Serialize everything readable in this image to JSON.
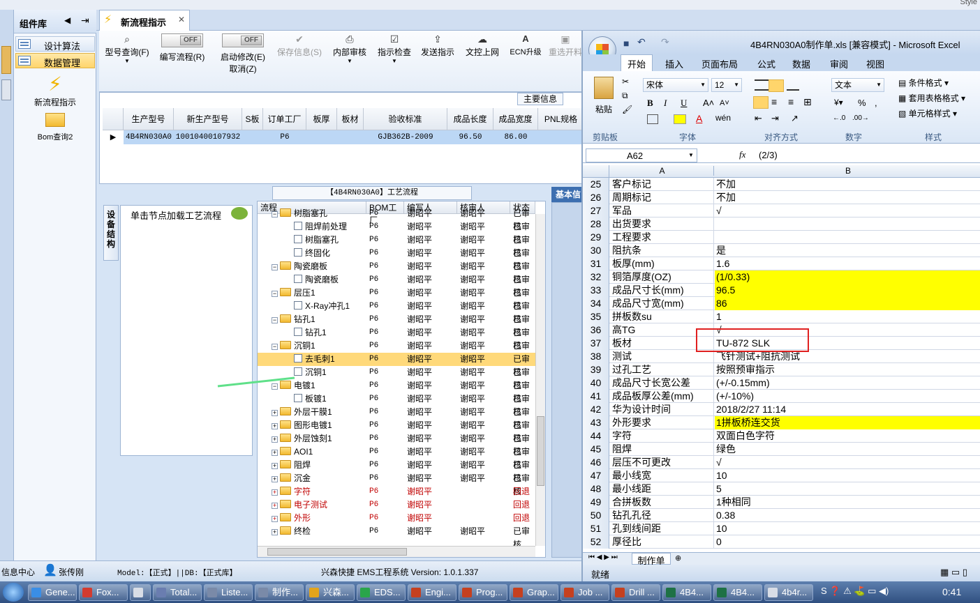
{
  "top": {
    "style_label": "Style"
  },
  "component_library": {
    "title": "组件库",
    "nav": [
      {
        "label": "设计算法"
      },
      {
        "label": "数据管理"
      }
    ],
    "shortcuts": [
      {
        "label": "新流程指示"
      },
      {
        "label": "Bom查询2"
      }
    ]
  },
  "doc_tab": {
    "label": "新流程指示"
  },
  "toolbar": {
    "items": [
      {
        "label": "型号查询(F)",
        "icon": "search-icon"
      },
      {
        "label": "编写流程(R)",
        "toggle": "OFF"
      },
      {
        "label": "启动修改(E)",
        "sub": "取消(Z)",
        "toggle": "OFF"
      },
      {
        "label": "保存信息(S)",
        "icon": "check-icon"
      },
      {
        "label": "内部审核",
        "icon": "printer-icon"
      },
      {
        "label": "指示检查",
        "icon": "checkbox-icon"
      },
      {
        "label": "发送指示",
        "icon": "upload-icon"
      },
      {
        "label": "文控上网",
        "icon": "cloud-upload-icon"
      },
      {
        "label": "ECN升级",
        "icon": "ecn-icon"
      },
      {
        "label": "重选开料",
        "icon": "image-icon"
      }
    ]
  },
  "main_info": {
    "label": "主要信息",
    "columns": [
      "生产型号",
      "新生产型号",
      "S板",
      "订单工厂",
      "板厚",
      "板材",
      "验收标准",
      "成品长度",
      "成品宽度",
      "PNL规格"
    ],
    "row": [
      "4B4RN030A0",
      "10010400107932",
      "",
      "P6",
      "",
      "",
      "GJB362B-2009",
      "96.50",
      "86.00",
      ""
    ]
  },
  "process": {
    "title": "【4B4RN030A0】工艺流程",
    "side_tab": "设备结构",
    "hint": "单击节点加载工艺流程",
    "basic_tab": "基本信",
    "columns": [
      "流程",
      "BOM工厂",
      "编写人",
      "核审人",
      "状态"
    ],
    "rows": [
      {
        "name": "树脂塞孔",
        "level": 1,
        "type": "folder",
        "f": "P6",
        "w": "谢昭平",
        "r": "谢昭平",
        "s": "已审核",
        "red": false,
        "hl": false
      },
      {
        "name": "阻焊前处理",
        "level": 2,
        "type": "file",
        "f": "P6",
        "w": "谢昭平",
        "r": "谢昭平",
        "s": "已审核",
        "red": false,
        "hl": false
      },
      {
        "name": "树脂塞孔",
        "level": 2,
        "type": "file",
        "f": "P6",
        "w": "谢昭平",
        "r": "谢昭平",
        "s": "已审核",
        "red": false,
        "hl": false
      },
      {
        "name": "终固化",
        "level": 2,
        "type": "file",
        "f": "P6",
        "w": "谢昭平",
        "r": "谢昭平",
        "s": "已审核",
        "red": false,
        "hl": false
      },
      {
        "name": "陶瓷磨板",
        "level": 1,
        "type": "folder",
        "f": "P6",
        "w": "谢昭平",
        "r": "谢昭平",
        "s": "已审核",
        "red": false,
        "hl": false
      },
      {
        "name": "陶瓷磨板",
        "level": 2,
        "type": "file",
        "f": "P6",
        "w": "谢昭平",
        "r": "谢昭平",
        "s": "已审核",
        "red": false,
        "hl": false
      },
      {
        "name": "层压1",
        "level": 1,
        "type": "folder",
        "f": "P6",
        "w": "谢昭平",
        "r": "谢昭平",
        "s": "已审核",
        "red": false,
        "hl": false
      },
      {
        "name": "X-Ray冲孔1",
        "level": 2,
        "type": "file",
        "f": "P6",
        "w": "谢昭平",
        "r": "谢昭平",
        "s": "已审核",
        "red": false,
        "hl": false
      },
      {
        "name": "钻孔1",
        "level": 1,
        "type": "folder",
        "f": "P6",
        "w": "谢昭平",
        "r": "谢昭平",
        "s": "已审核",
        "red": false,
        "hl": false
      },
      {
        "name": "钻孔1",
        "level": 2,
        "type": "file",
        "f": "P6",
        "w": "谢昭平",
        "r": "谢昭平",
        "s": "已审核",
        "red": false,
        "hl": false
      },
      {
        "name": "沉铜1",
        "level": 1,
        "type": "folder",
        "f": "P6",
        "w": "谢昭平",
        "r": "谢昭平",
        "s": "已审核",
        "red": false,
        "hl": false
      },
      {
        "name": "去毛刺1",
        "level": 2,
        "type": "file",
        "f": "P6",
        "w": "谢昭平",
        "r": "谢昭平",
        "s": "已审核",
        "red": false,
        "hl": true
      },
      {
        "name": "沉铜1",
        "level": 2,
        "type": "file",
        "f": "P6",
        "w": "谢昭平",
        "r": "谢昭平",
        "s": "已审核",
        "red": false,
        "hl": false
      },
      {
        "name": "电镀1",
        "level": 1,
        "type": "folder",
        "f": "P6",
        "w": "谢昭平",
        "r": "谢昭平",
        "s": "已审核",
        "red": false,
        "hl": false
      },
      {
        "name": "板镀1",
        "level": 2,
        "type": "file",
        "f": "P6",
        "w": "谢昭平",
        "r": "谢昭平",
        "s": "已审核",
        "red": false,
        "hl": false
      },
      {
        "name": "外层干膜1",
        "level": 1,
        "type": "folder",
        "f": "P6",
        "w": "谢昭平",
        "r": "谢昭平",
        "s": "已审核",
        "red": false,
        "hl": false
      },
      {
        "name": "图形电镀1",
        "level": 1,
        "type": "folder",
        "f": "P6",
        "w": "谢昭平",
        "r": "谢昭平",
        "s": "已审核",
        "red": false,
        "hl": false
      },
      {
        "name": "外层蚀刻1",
        "level": 1,
        "type": "folder",
        "f": "P6",
        "w": "谢昭平",
        "r": "谢昭平",
        "s": "已审核",
        "red": false,
        "hl": false
      },
      {
        "name": "AOI1",
        "level": 1,
        "type": "folder",
        "f": "P6",
        "w": "谢昭平",
        "r": "谢昭平",
        "s": "已审核",
        "red": false,
        "hl": false
      },
      {
        "name": "阻焊",
        "level": 1,
        "type": "folder",
        "f": "P6",
        "w": "谢昭平",
        "r": "谢昭平",
        "s": "已审核",
        "red": false,
        "hl": false
      },
      {
        "name": "沉金",
        "level": 1,
        "type": "folder",
        "f": "P6",
        "w": "谢昭平",
        "r": "谢昭平",
        "s": "已审核",
        "red": false,
        "hl": false
      },
      {
        "name": "字符",
        "level": 1,
        "type": "folder",
        "f": "P6",
        "w": "谢昭平",
        "r": "",
        "s": "回退",
        "red": true,
        "hl": false
      },
      {
        "name": "电子测试",
        "level": 1,
        "type": "folder",
        "f": "P6",
        "w": "谢昭平",
        "r": "",
        "s": "回退",
        "red": true,
        "hl": false
      },
      {
        "name": "外形",
        "level": 1,
        "type": "folder",
        "f": "P6",
        "w": "谢昭平",
        "r": "",
        "s": "回退",
        "red": true,
        "hl": false
      },
      {
        "name": "终检",
        "level": 1,
        "type": "folder",
        "f": "P6",
        "w": "谢昭平",
        "r": "谢昭平",
        "s": "已审核",
        "red": false,
        "hl": false
      }
    ]
  },
  "status_bar": {
    "info": "信息中心",
    "user": "张传刚",
    "model": "Model:【正式】||DB:【正式库】",
    "system": "兴森快捷 EMS工程系统 Version: 1.0.1.337"
  },
  "excel": {
    "title": "4B4RN030A0制作单.xls [兼容模式] - Microsoft Excel",
    "tabs": [
      "开始",
      "插入",
      "页面布局",
      "公式",
      "数据",
      "审阅",
      "视图"
    ],
    "font": "宋体",
    "font_size": "12",
    "number_format": "文本",
    "groups": [
      "剪贴板",
      "字体",
      "对齐方式",
      "数字",
      "样式"
    ],
    "styles": [
      "条件格式",
      "套用表格格式",
      "单元格样式"
    ],
    "paste": "粘贴",
    "name_box": "A62",
    "formula": "(2/3)",
    "col_a": "A",
    "col_b": "B",
    "rows": [
      {
        "n": "25",
        "a": "客户标记",
        "b": "不加",
        "y": false
      },
      {
        "n": "26",
        "a": "周期标记",
        "b": "不加",
        "y": false
      },
      {
        "n": "27",
        "a": "军品",
        "b": "√",
        "y": false
      },
      {
        "n": "28",
        "a": "出货要求",
        "b": "",
        "y": false
      },
      {
        "n": "29",
        "a": "工程要求",
        "b": "",
        "y": false
      },
      {
        "n": "30",
        "a": "阻抗条",
        "b": "是",
        "y": false
      },
      {
        "n": "31",
        "a": "板厚(mm)",
        "b": "1.6",
        "y": false
      },
      {
        "n": "32",
        "a": "铜箔厚度(OZ)",
        "b": "(1/0.33)",
        "y": true
      },
      {
        "n": "33",
        "a": "成品尺寸长(mm)",
        "b": "96.5",
        "y": true
      },
      {
        "n": "34",
        "a": "成品尺寸宽(mm)",
        "b": "86",
        "y": true
      },
      {
        "n": "35",
        "a": "拼板数su",
        "b": "1",
        "y": false
      },
      {
        "n": "36",
        "a": "高TG",
        "b": "√",
        "y": false
      },
      {
        "n": "37",
        "a": "板材",
        "b": "TU-872 SLK",
        "y": false
      },
      {
        "n": "38",
        "a": "测试",
        "b": "飞针测试+阻抗测试",
        "y": false
      },
      {
        "n": "39",
        "a": "过孔工艺",
        "b": "按照预审指示",
        "y": false
      },
      {
        "n": "40",
        "a": "成品尺寸长宽公差",
        "b": "(+/-0.15mm)",
        "y": false
      },
      {
        "n": "41",
        "a": "成品板厚公差(mm)",
        "b": "(+/-10%)",
        "y": false
      },
      {
        "n": "42",
        "a": "华为设计时间",
        "b": "2018/2/27 11:14",
        "y": false
      },
      {
        "n": "43",
        "a": "外形要求",
        "b": "1拼板桥连交货",
        "y": true
      },
      {
        "n": "44",
        "a": "字符",
        "b": "双面白色字符",
        "y": false
      },
      {
        "n": "45",
        "a": "阻焊",
        "b": "绿色",
        "y": false
      },
      {
        "n": "46",
        "a": "层压不可更改",
        "b": "√",
        "y": false
      },
      {
        "n": "47",
        "a": "最小线宽",
        "b": "10",
        "y": false
      },
      {
        "n": "48",
        "a": "最小线距",
        "b": "5",
        "y": false
      },
      {
        "n": "49",
        "a": "合拼板数",
        "b": "1种相同",
        "y": false
      },
      {
        "n": "50",
        "a": "钻孔孔径",
        "b": "0.38",
        "y": false
      },
      {
        "n": "51",
        "a": "孔到线间距",
        "b": "10",
        "y": false
      },
      {
        "n": "52",
        "a": "厚径比",
        "b": "0",
        "y": false
      }
    ],
    "sheet_tab": "制作单",
    "status": "就绪"
  },
  "taskbar": {
    "items": [
      {
        "label": "Gene...",
        "color": "#3a8ee6"
      },
      {
        "label": "Fox...",
        "color": "#d23b2f"
      },
      {
        "label": "",
        "color": "#d8dde6"
      },
      {
        "label": "Total...",
        "color": "#6a7db0"
      },
      {
        "label": "Liste...",
        "color": "#7a8aa8"
      },
      {
        "label": "制作...",
        "color": "#7a8aa8"
      },
      {
        "label": "兴森...",
        "color": "#e2a41c"
      },
      {
        "label": "EDS...",
        "color": "#2aa54a"
      },
      {
        "label": "Engi...",
        "color": "#c5401f"
      },
      {
        "label": "Prog...",
        "color": "#c5401f"
      },
      {
        "label": "Grap...",
        "color": "#c5401f"
      },
      {
        "label": "Job ...",
        "color": "#c5401f"
      },
      {
        "label": "Drill ...",
        "color": "#c5401f"
      },
      {
        "label": "4B4...",
        "color": "#1e7145"
      },
      {
        "label": "4B4...",
        "color": "#1e7145"
      },
      {
        "label": "4b4r...",
        "color": "#d8dde6"
      }
    ],
    "clock": "0:41"
  }
}
